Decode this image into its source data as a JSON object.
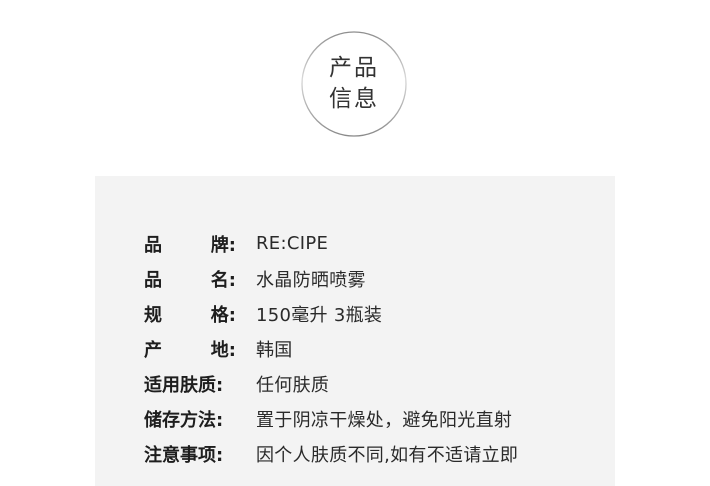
{
  "badge": {
    "line1": "产品",
    "line2": "信息"
  },
  "rows": [
    {
      "label_a": "品",
      "label_b": "牌:",
      "value": "RE:CIPE"
    },
    {
      "label_a": "品",
      "label_b": "名:",
      "value": "水晶防晒喷雾"
    },
    {
      "label_a": "规",
      "label_b": "格:",
      "value": "150毫升 3瓶装"
    },
    {
      "label_a": "产",
      "label_b": "地:",
      "value": "韩国"
    },
    {
      "label": "适用肤质:",
      "value": "任何肤质"
    },
    {
      "label": "储存方法:",
      "value": "置于阴凉干燥处，避免阳光直射"
    },
    {
      "label": "注意事项:",
      "value": "因个人肤质不同,如有不适请立即"
    }
  ]
}
